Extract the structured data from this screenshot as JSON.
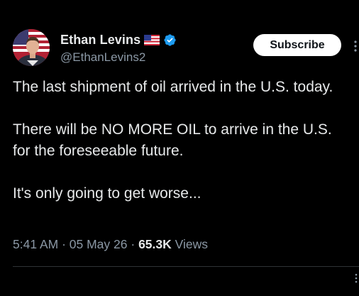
{
  "author": {
    "display_name": "Ethan Levins",
    "flag_icon": "us-flag-icon",
    "verified_icon": "verified-badge-icon",
    "handle": "@EthanLevins2"
  },
  "subscribe_label": "Subscribe",
  "tweet": {
    "paragraphs": [
      "The last shipment of oil arrived in the U.S. today.",
      "There will be NO MORE OIL to arrive in the U.S. for the foreseeable future.",
      "It's only going to get worse..."
    ]
  },
  "meta": {
    "time": "5:41 AM",
    "separator": " · ",
    "date": "05 May 26",
    "views_count": "65.3K",
    "views_label": " Views"
  },
  "colors": {
    "background": "#000000",
    "text_primary": "#e7e9ea",
    "text_secondary": "#8b98a5",
    "verified_blue": "#1d9bf0",
    "divider": "#2f3336"
  }
}
